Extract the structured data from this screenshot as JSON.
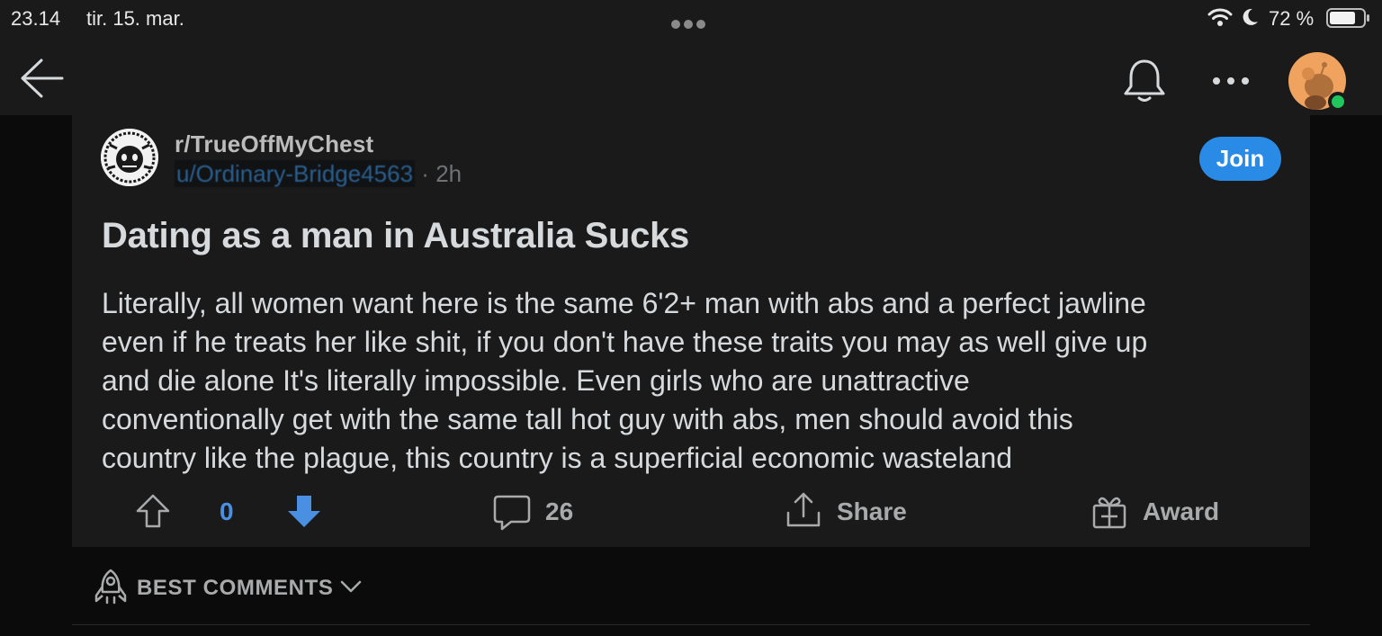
{
  "status_bar": {
    "time": "23.14",
    "date": "tir. 15. mar.",
    "battery_percent": "72 %"
  },
  "nav": {
    "back_icon": "arrow-left-icon",
    "notifications_icon": "bell-icon",
    "more_icon": "more-horizontal-icon",
    "avatar_icon": "user-avatar"
  },
  "post": {
    "subreddit": "r/TrueOffMyChest",
    "username": "u/Ordinary-Bridge4563",
    "separator": "·",
    "age": "2h",
    "join_label": "Join",
    "title": "Dating as a man in Australia Sucks",
    "body_lines": [
      "Literally, all women want here is the same 6'2+ man with abs and a perfect jawline",
      "even if he treats her like shit, if you don't have these traits you may as well give up",
      "and die alone It's literally impossible. Even girls who are unattractive",
      "conventionally get with the same tall hot guy with abs, men should avoid this",
      "country like the plague, this country is a superficial economic wasteland"
    ]
  },
  "actions": {
    "vote_count": "0",
    "comments_count": "26",
    "share_label": "Share",
    "award_label": "Award"
  },
  "sort": {
    "label": "BEST COMMENTS"
  },
  "colors": {
    "background": "#0b0b0b",
    "card": "#1a1a1b",
    "accent_blue": "#2a8be6",
    "vote_blue": "#4a90e2",
    "online_green": "#21c55d"
  }
}
